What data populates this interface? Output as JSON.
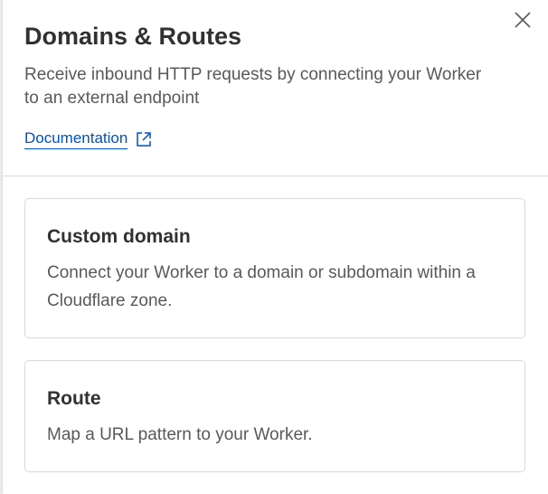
{
  "panel": {
    "title": "Domains & Routes",
    "description": "Receive inbound HTTP requests by connecting your Worker to an external endpoint",
    "documentation_link": "Documentation"
  },
  "options": [
    {
      "title": "Custom domain",
      "description": "Connect your Worker to a domain or subdomain within a Cloudflare zone."
    },
    {
      "title": "Route",
      "description": "Map a URL pattern to your Worker."
    }
  ],
  "icons": {
    "close": "close-icon",
    "external_link": "external-link-icon"
  },
  "colors": {
    "link": "#0051c3",
    "border": "#d9d9d9",
    "text_primary": "#313131",
    "text_secondary": "#595959"
  }
}
